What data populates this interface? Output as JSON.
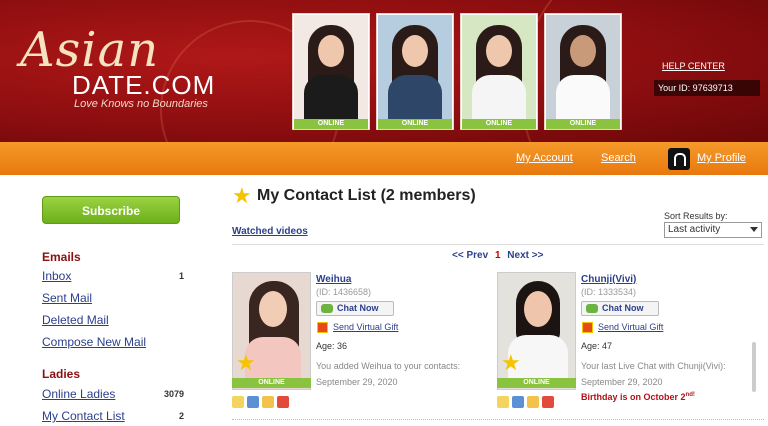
{
  "brand": {
    "script": "Asian",
    "name": "DATE.COM",
    "tagline": "Love Knows no Boundaries"
  },
  "featured": [
    {
      "status": "ONLINE",
      "top": "#f3e9e4",
      "outfit": "#1b1b1b"
    },
    {
      "status": "ONLINE",
      "top": "#b6cde0",
      "outfit": "#2e4668"
    },
    {
      "status": "ONLINE",
      "top": "#d6e7c4",
      "outfit": "#f5f5f5"
    },
    {
      "status": "ONLINE",
      "top": "#c9d1d8",
      "outfit": "#fafafa"
    }
  ],
  "header": {
    "help_center": "HELP CENTER",
    "your_id": "Your ID: 97639713"
  },
  "nav": {
    "my_account": "My Account",
    "search": "Search",
    "my_profile": "My Profile"
  },
  "sidebar": {
    "subscribe": "Subscribe",
    "emails_heading": "Emails",
    "inbox": "Inbox",
    "inbox_count": "1",
    "sent": "Sent Mail",
    "deleted": "Deleted Mail",
    "compose": "Compose New Mail",
    "ladies_heading": "Ladies",
    "online_ladies": "Online Ladies",
    "online_count": "3079",
    "contact_list": "My Contact List",
    "contact_count": "2"
  },
  "main": {
    "title_prefix": "My Contact List (",
    "title_count": "2",
    "title_suffix": " members)",
    "watched_videos": "Watched videos",
    "sort_label": "Sort Results by:",
    "sort_value": "Last activity",
    "prev": "<< Prev",
    "page": "1",
    "next": "Next >>"
  },
  "contacts": [
    {
      "name": "Weihua",
      "id": "(ID: 1436658)",
      "chat": "Chat Now",
      "gift": "Send Virtual Gift",
      "age": "Age: 36",
      "note": "You added Weihua to your contacts:",
      "date": "September 29, 2020",
      "online": "ONLINE"
    },
    {
      "name": "Chunji(Vivi)",
      "id": "(ID: 1333534)",
      "chat": "Chat Now",
      "gift": "Send Virtual Gift",
      "age": "Age: 47",
      "note": "Your last Live Chat with Chunji(Vivi):",
      "date": "September 29, 2020",
      "online": "ONLINE",
      "birthday_prefix": "Birthday is on  October 2",
      "birthday_suffix": "nd!"
    }
  ],
  "colors": {
    "header_red": "#8e0e10",
    "nav_orange": "#f08a1c",
    "online_green": "#8ac33f",
    "link_blue": "#2b3f8c",
    "heading_red": "#8b1010"
  },
  "icons": [
    "star-icon",
    "chat-icon",
    "gift-icon",
    "profile-icon",
    "caret-down-icon"
  ]
}
